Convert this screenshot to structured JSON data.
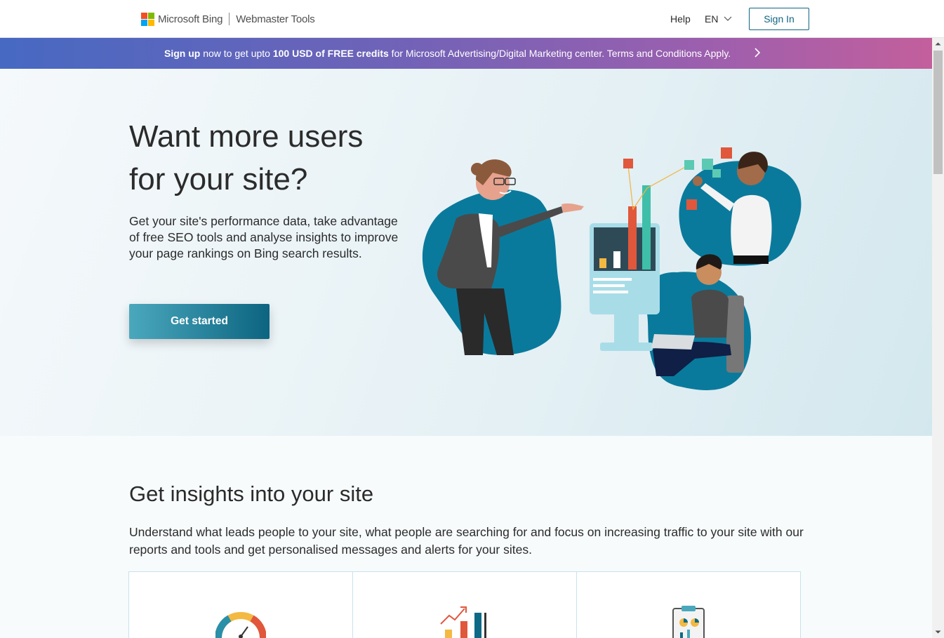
{
  "header": {
    "brand": "Microsoft Bing",
    "product": "Webmaster Tools",
    "help": "Help",
    "language": "EN",
    "sign_in": "Sign In",
    "brand_colors": [
      "#f25022",
      "#7fba00",
      "#00a4ef",
      "#ffb900"
    ]
  },
  "promo": {
    "sign_up": "Sign up",
    "text1": " now to get upto ",
    "credits": "100 USD of FREE credits",
    "text2": " for Microsoft Advertising/Digital Marketing center.  Terms and Conditions Apply."
  },
  "hero": {
    "title_line1": "Want more users",
    "title_line2": "for your site?",
    "description": "Get your site's performance data, take advantage of free SEO tools and analyse insights to improve your page rankings on Bing search results.",
    "cta": "Get started"
  },
  "insights": {
    "title": "Get insights into your site",
    "description": "Understand what leads people to your site, what people are searching for and focus on increasing traffic to your site with our reports and tools and get personalised messages and alerts for your sites."
  },
  "icons": [
    "gauge-icon",
    "growth-chart-icon",
    "clipboard-report-icon"
  ],
  "colors": {
    "accent": "#0f6582",
    "banner_start": "#4769c2",
    "banner_end": "#c35f9c",
    "hero_blob": "#0a7a9c"
  }
}
